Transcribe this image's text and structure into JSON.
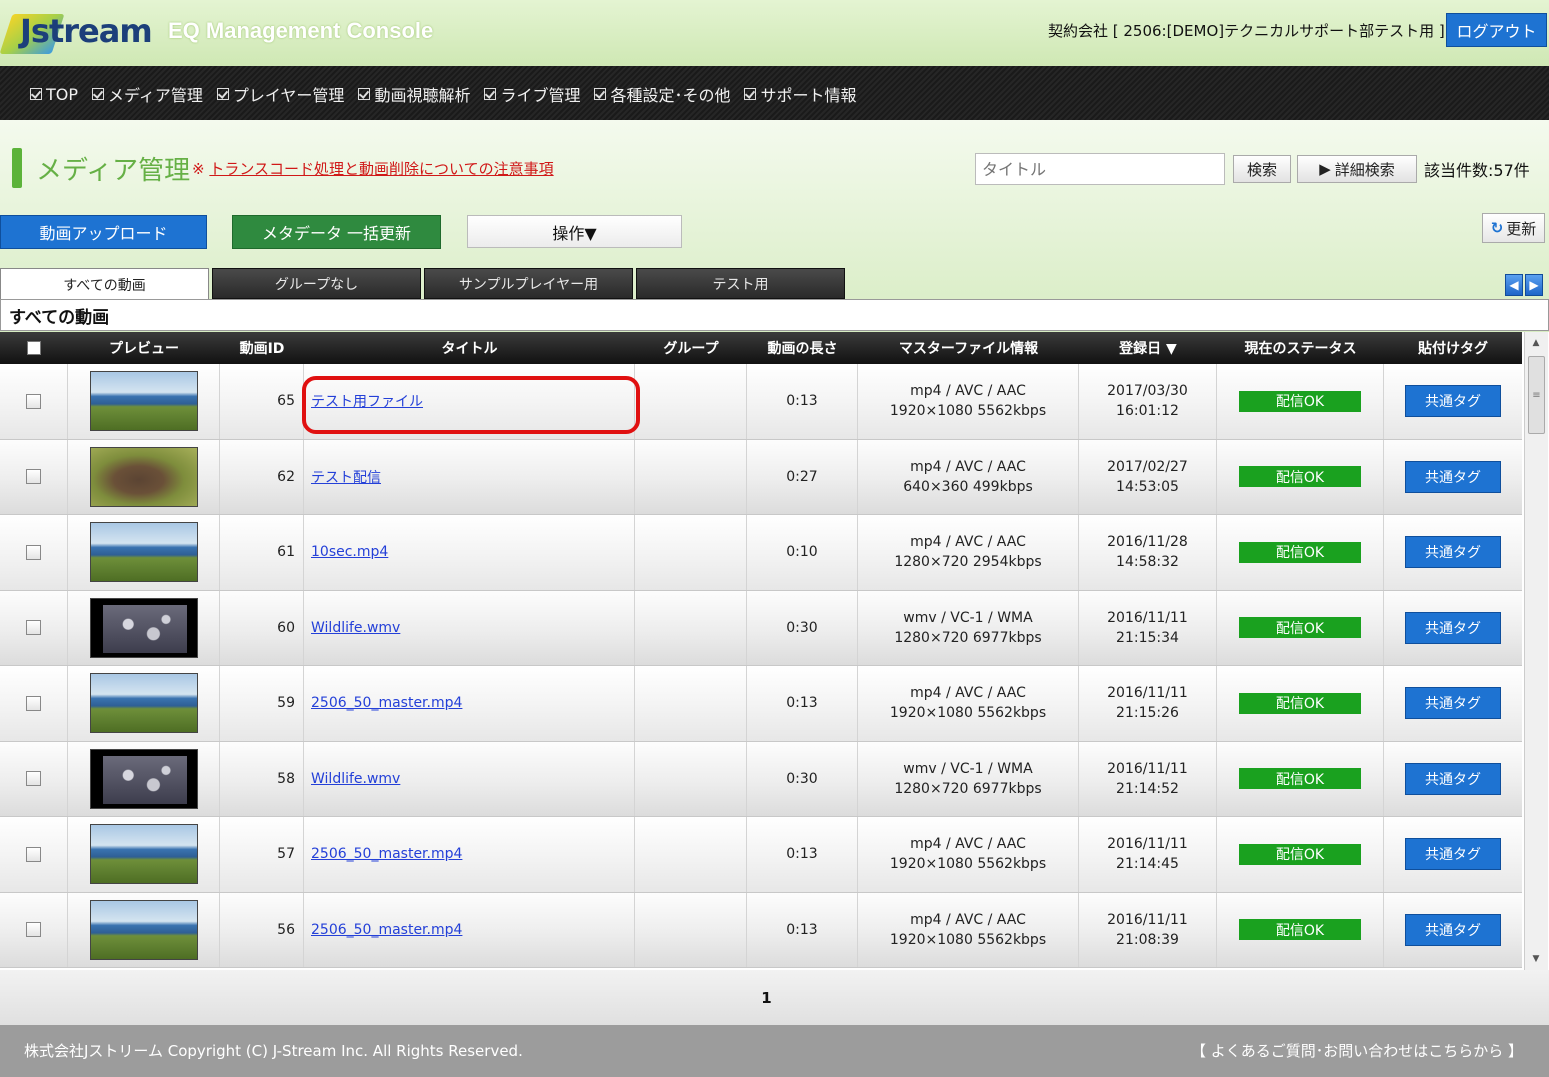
{
  "header": {
    "logo_text": "Jstream",
    "console_title": "EQ Management Console",
    "contract": "契約会社 [ 2506:[DEMO]テクニカルサポート部テスト用 ]",
    "logout_label": "ログアウト"
  },
  "nav": {
    "items": [
      "TOP",
      "メディア管理",
      "プレイヤー管理",
      "動画視聴解析",
      "ライブ管理",
      "各種設定･その他",
      "サポート情報"
    ]
  },
  "page": {
    "title": "メディア管理",
    "notice_mark": "※",
    "notice_link": "トランスコード処理と動画削除についての注意事項",
    "search_placeholder": "タイトル",
    "search_label": "検索",
    "advanced_search_label": "詳細検索",
    "count_label": "該当件数:57件"
  },
  "actions": {
    "upload_label": "動画アップロード",
    "metadata_label": "メタデータ 一括更新",
    "operation_label": "操作▼",
    "refresh_label": "更新"
  },
  "tabs": [
    "すべての動画",
    "グループなし",
    "サンプルプレイヤー用",
    "テスト用"
  ],
  "section_title": "すべての動画",
  "table": {
    "headers": [
      "プレビュー",
      "動画ID",
      "タイトル",
      "グループ",
      "動画の長さ",
      "マスターファイル情報",
      "登録日 ▼",
      "現在のステータス",
      "貼付けタグ"
    ],
    "rows": [
      {
        "thumb": "coast",
        "id": "65",
        "title": "テスト用ファイル",
        "group": "",
        "length": "0:13",
        "info1": "mp4 / AVC / AAC",
        "info2": "1920×1080  5562kbps",
        "date1": "2017/03/30",
        "date2": "16:01:12",
        "status": "配信OK",
        "tag": "共通タグ"
      },
      {
        "thumb": "animal",
        "id": "62",
        "title": "テスト配信",
        "group": "",
        "length": "0:27",
        "info1": "mp4 / AVC / AAC",
        "info2": "640×360  499kbps",
        "date1": "2017/02/27",
        "date2": "14:53:05",
        "status": "配信OK",
        "tag": "共通タグ"
      },
      {
        "thumb": "coast",
        "id": "61",
        "title": "10sec.mp4",
        "group": "",
        "length": "0:10",
        "info1": "mp4 / AVC / AAC",
        "info2": "1280×720  2954kbps",
        "date1": "2016/11/28",
        "date2": "14:58:32",
        "status": "配信OK",
        "tag": "共通タグ"
      },
      {
        "thumb": "birds",
        "id": "60",
        "title": "Wildlife.wmv",
        "group": "",
        "length": "0:30",
        "info1": "wmv / VC-1 / WMA",
        "info2": "1280×720  6977kbps",
        "date1": "2016/11/11",
        "date2": "21:15:34",
        "status": "配信OK",
        "tag": "共通タグ"
      },
      {
        "thumb": "coast",
        "id": "59",
        "title": "2506_50_master.mp4",
        "group": "",
        "length": "0:13",
        "info1": "mp4 / AVC / AAC",
        "info2": "1920×1080  5562kbps",
        "date1": "2016/11/11",
        "date2": "21:15:26",
        "status": "配信OK",
        "tag": "共通タグ"
      },
      {
        "thumb": "birds",
        "id": "58",
        "title": "Wildlife.wmv",
        "group": "",
        "length": "0:30",
        "info1": "wmv / VC-1 / WMA",
        "info2": "1280×720  6977kbps",
        "date1": "2016/11/11",
        "date2": "21:14:52",
        "status": "配信OK",
        "tag": "共通タグ"
      },
      {
        "thumb": "coast",
        "id": "57",
        "title": "2506_50_master.mp4",
        "group": "",
        "length": "0:13",
        "info1": "mp4 / AVC / AAC",
        "info2": "1920×1080  5562kbps",
        "date1": "2016/11/11",
        "date2": "21:14:45",
        "status": "配信OK",
        "tag": "共通タグ"
      },
      {
        "thumb": "coast",
        "id": "56",
        "title": "2506_50_master.mp4",
        "group": "",
        "length": "0:13",
        "info1": "mp4 / AVC / AAC",
        "info2": "1920×1080  5562kbps",
        "date1": "2016/11/11",
        "date2": "21:08:39",
        "status": "配信OK",
        "tag": "共通タグ"
      }
    ]
  },
  "pager": {
    "current": "1"
  },
  "footer": {
    "copyright": "株式会社Jストリーム  Copyright (C) J-Stream Inc. All Rights Reserved.",
    "faq": "【 よくあるご質問･お問い合わせはこちらから 】"
  },
  "colors": {
    "brand_blue": "#1e73d2",
    "brand_green": "#2f8a3f",
    "status_green": "#1aa11f",
    "accent_green": "#66b046",
    "notice_red": "#d01818"
  }
}
